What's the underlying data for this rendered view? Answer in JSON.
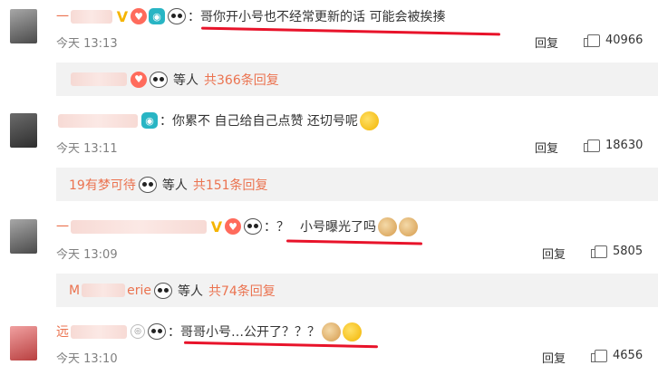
{
  "comments": [
    {
      "user_visible": "一",
      "text": "：哥你开小号也不经常更新的话 可能会被挨揍",
      "time": "今天 13:13",
      "reply_label": "回复",
      "likes": "40966",
      "sub": {
        "user_visible": "",
        "etc": "等人",
        "count": "共366条回复"
      }
    },
    {
      "user_visible": "",
      "text": "：你累不 自己给自己点赞 还切号呢",
      "time": "今天 13:11",
      "reply_label": "回复",
      "likes": "18630",
      "sub": {
        "user_visible": "19有梦可待",
        "etc": "等人",
        "count": "共151条回复"
      }
    },
    {
      "user_visible": "一",
      "text_q": "：？",
      "text": "小号曝光了吗",
      "time": "今天 13:09",
      "reply_label": "回复",
      "likes": "5805",
      "sub": {
        "user_visible_a": "M",
        "user_visible_b": "erie",
        "etc": "等人",
        "count": "共74条回复"
      }
    },
    {
      "user_visible": "远",
      "text": "：哥哥小号…公开了？？？",
      "time": "今天 13:10",
      "reply_label": "回复",
      "likes": "4656"
    }
  ],
  "colors": {
    "accent": "#eb7350",
    "underline": "#e8132a",
    "meta": "#808080",
    "subbox": "#f2f2f2"
  },
  "icons": [
    "vip-v-icon",
    "heart-fan-icon",
    "camera-icon",
    "panda-emoji-icon",
    "thumbs-up-icon",
    "medal-icon",
    "cat-emoji-icon",
    "blush-emoji-icon",
    "thinking-emoji-icon"
  ]
}
